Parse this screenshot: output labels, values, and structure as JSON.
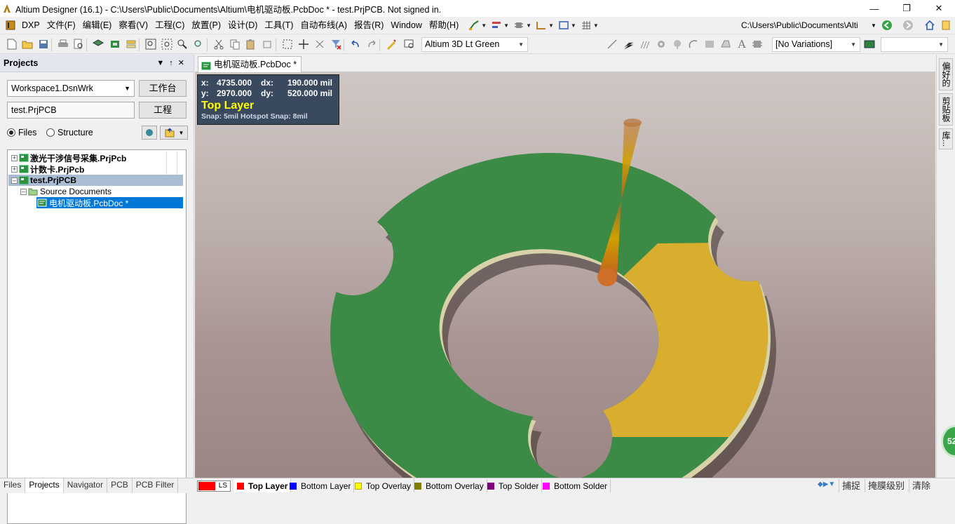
{
  "window": {
    "title": "Altium Designer (16.1) - C:\\Users\\Public\\Documents\\Altium\\电机驱动板.PcbDoc * - test.PrjPCB. Not signed in."
  },
  "menu": [
    "DXP",
    "文件(F)",
    "编辑(E)",
    "察看(V)",
    "工程(C)",
    "放置(P)",
    "设计(D)",
    "工具(T)",
    "自动布线(A)",
    "报告(R)",
    "Window",
    "帮助(H)"
  ],
  "nav_path": "C:\\Users\\Public\\Documents\\Alti",
  "toolbar": {
    "view_config": "Altium 3D Lt Green",
    "variations": "[No Variations]"
  },
  "projects_panel": {
    "title": "Projects",
    "workspace": "Workspace1.DsnWrk",
    "workspace_button": "工作台",
    "project": "test.PrjPCB",
    "project_button": "工程",
    "radio_files": "Files",
    "radio_structure": "Structure",
    "selected_view": "Files",
    "tree": [
      {
        "label": "激光干涉信号采集.PrjPcb",
        "level": 0,
        "expanded": false
      },
      {
        "label": "计数卡.PrjPcb",
        "level": 0,
        "expanded": false
      },
      {
        "label": "test.PrjPCB",
        "level": 0,
        "expanded": true
      },
      {
        "label": "Source Documents",
        "level": 1,
        "expanded": true
      },
      {
        "label": "电机驱动板.PcbDoc *",
        "level": 2,
        "selected": true
      }
    ]
  },
  "left_tabs": [
    "Files",
    "Projects",
    "Navigator",
    "PCB",
    "PCB Filter"
  ],
  "active_left_tab": "Projects",
  "document_tab": "电机驱动板.PcbDoc *",
  "hud": {
    "x_label": "x:",
    "x": "4735.000",
    "dx_label": "dx:",
    "dx": "190.000 mil",
    "y_label": "y:",
    "y": "2970.000",
    "dy_label": "dy:",
    "dy": "520.000 mil",
    "layer": "Top Layer",
    "snap": "Snap: 5mil Hotspot Snap: 8mil"
  },
  "right_strip": [
    "偏好的",
    "剪贴板",
    "库..."
  ],
  "badge": "52",
  "layer_tabs": [
    {
      "label": "Top Layer",
      "color": "#ff0000",
      "active": true
    },
    {
      "label": "Bottom Layer",
      "color": "#0000ff"
    },
    {
      "label": "Top Overlay",
      "color": "#ffff00"
    },
    {
      "label": "Bottom Overlay",
      "color": "#808000"
    },
    {
      "label": "Top Solder",
      "color": "#800080"
    },
    {
      "label": "Bottom Solder",
      "color": "#ff00ff"
    }
  ],
  "ls_label": "LS",
  "status_right": [
    "捕捉",
    "掩膜级别",
    "清除"
  ],
  "colors": {
    "board_green": "#3b8a45",
    "copper_yellow": "#d9ae2e",
    "hud_bg": "#3a4a5e"
  }
}
